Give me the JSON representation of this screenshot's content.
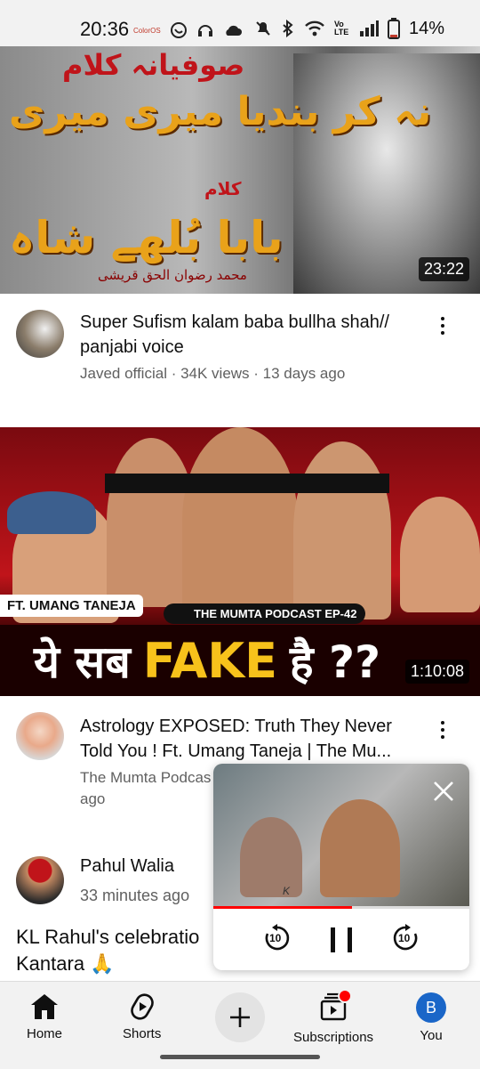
{
  "status_bar": {
    "time": "20:36",
    "small_badge": "ColorOS",
    "battery": "14%"
  },
  "video1": {
    "thumb_text_top": "صوفیانہ کلام",
    "thumb_text_main": "نہ کر بندیا میری میری",
    "thumb_text_small": "کلام",
    "thumb_text_name": "بابا بُلھے شاہ",
    "thumb_text_credit": "محمد رضوان الحق قریشی",
    "duration": "23:22",
    "title": "Super Sufism kalam baba bullha shah// panjabi voice",
    "meta": "Javed official · 34K views · 13 days ago"
  },
  "video2": {
    "thumb_label_guest": "FT. UMANG TANEJA",
    "thumb_label_show": "THE MUMTA PODCAST EP-42",
    "thumb_headline_left": "ये सब",
    "thumb_headline_mid": "FAKE",
    "thumb_headline_right": "है ??",
    "duration": "1:10:08",
    "title": "Astrology EXPOSED: Truth They Never Told You ! Ft. Umang Taneja | The Mu...",
    "meta_line1": "The Mumta Podcas",
    "meta_line2": "ago"
  },
  "post": {
    "author": "Pahul Walia",
    "time": "33 minutes ago",
    "text_line1": "KL Rahul's celebratio",
    "text_line2": "Kantara 🙏"
  },
  "miniplayer": {
    "progress": 0.54,
    "close_icon": "close-icon",
    "rewind_label": "10",
    "forward_label": "10",
    "thumb_credit": "K"
  },
  "bottom_nav": {
    "items": [
      {
        "label": "Home",
        "icon": "home-icon"
      },
      {
        "label": "Shorts",
        "icon": "shorts-icon"
      },
      {
        "label": "",
        "icon": "create-icon"
      },
      {
        "label": "Subscriptions",
        "icon": "subscriptions-icon"
      },
      {
        "label": "You",
        "icon": "account-avatar",
        "avatar_letter": "B"
      }
    ]
  },
  "colors": {
    "accent_red": "#ff0000",
    "text_primary": "#0f0f0f",
    "text_secondary": "#606060",
    "avatar_blue": "#1a66c8"
  }
}
